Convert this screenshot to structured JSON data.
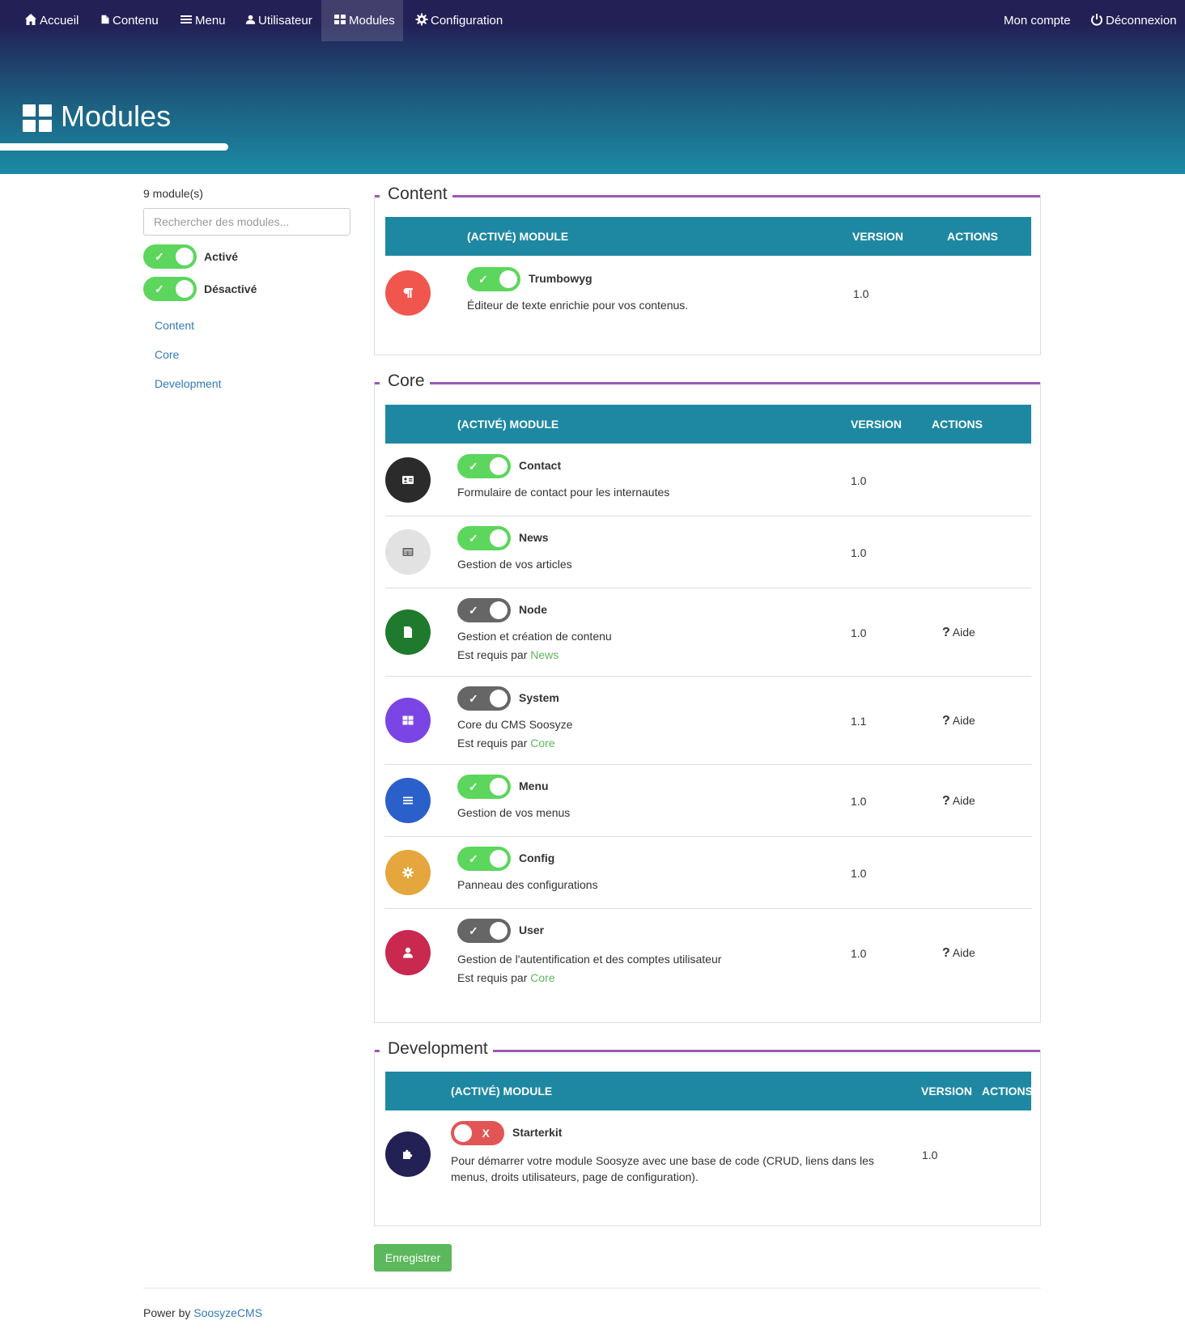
{
  "nav": {
    "items": [
      {
        "label": "Accueil",
        "icon": "home-icon"
      },
      {
        "label": "Contenu",
        "icon": "file-icon"
      },
      {
        "label": "Menu",
        "icon": "bars-icon"
      },
      {
        "label": "Utilisateur",
        "icon": "user-icon"
      },
      {
        "label": "Modules",
        "icon": "th-large-icon",
        "active": true
      },
      {
        "label": "Configuration",
        "icon": "gear-icon"
      }
    ],
    "account": "Mon compte",
    "logout": "Déconnexion"
  },
  "page": {
    "title": "Modules"
  },
  "sidebar": {
    "count": "9 module(s)",
    "search_placeholder": "Rechercher des modules...",
    "filter_active": "Activé",
    "filter_inactive": "Désactivé",
    "links": [
      "Content",
      "Core",
      "Development"
    ]
  },
  "table_headers": {
    "module": "(ACTIVÉ) MODULE",
    "version": "VERSION",
    "actions": "ACTIONS"
  },
  "groups": [
    {
      "title": "Content",
      "modules": [
        {
          "name": "Trumbowyg",
          "description": "Éditeur de texte enrichie pour vos contenus.",
          "version": "1.0",
          "status": "on",
          "icon": "paragraph-icon",
          "color": "#f0564e"
        }
      ]
    },
    {
      "title": "Core",
      "modules": [
        {
          "name": "Contact",
          "description": "Formulaire de contact pour les internautes",
          "version": "1.0",
          "status": "on",
          "icon": "address-card-icon",
          "color": "#2b2b2b"
        },
        {
          "name": "News",
          "description": "Gestion de vos articles",
          "version": "1.0",
          "status": "on",
          "icon": "newspaper-icon",
          "color": "#e2e2e2"
        },
        {
          "name": "Node",
          "description": "Gestion et création de contenu",
          "required_prefix": "Est requis par",
          "required_by": "News",
          "version": "1.0",
          "status": "locked",
          "icon": "file-icon",
          "color": "#1f7a2e",
          "help": "Aide"
        },
        {
          "name": "System",
          "description": "Core du CMS Soosyze",
          "required_prefix": "Est requis par",
          "required_by": "Core",
          "version": "1.1",
          "status": "locked",
          "icon": "th-large-icon",
          "color": "#7b45e6",
          "help": "Aide"
        },
        {
          "name": "Menu",
          "description": "Gestion de vos menus",
          "version": "1.0",
          "status": "on",
          "icon": "bars-icon",
          "color": "#2b5fc9",
          "help": "Aide"
        },
        {
          "name": "Config",
          "description": "Panneau des configurations",
          "version": "1.0",
          "status": "on",
          "icon": "gear-icon",
          "color": "#e4a63d"
        },
        {
          "name": "User",
          "description": "Gestion de l'autentification et des comptes utilisateur",
          "required_prefix": "Est requis par",
          "required_by": "Core",
          "version": "1.0",
          "status": "locked",
          "icon": "user-icon",
          "color": "#c9294f",
          "help": "Aide"
        }
      ]
    },
    {
      "title": "Development",
      "modules": [
        {
          "name": "Starterkit",
          "description": "Pour démarrer votre module Soosyze avec une base de code (CRUD, liens dans les menus, droits utilisateurs, page de configuration).",
          "version": "1.0",
          "status": "off",
          "icon": "puzzle-icon",
          "color": "#232056"
        }
      ]
    }
  ],
  "toggle_marks": {
    "on": "✓",
    "off": "X"
  },
  "save_label": "Enregistrer",
  "footer": {
    "prefix": "Power by",
    "link": "SoosyzeCMS"
  },
  "colors": {
    "header_dark": "#232056",
    "header_teal": "#1c8aa3",
    "table_header": "#1e88a3",
    "legend_line": "#9b59b6",
    "toggle_on": "#5cd65c",
    "toggle_locked": "#666666",
    "toggle_off": "#e25555",
    "link": "#337ab7",
    "required_link": "#5cb85c"
  }
}
